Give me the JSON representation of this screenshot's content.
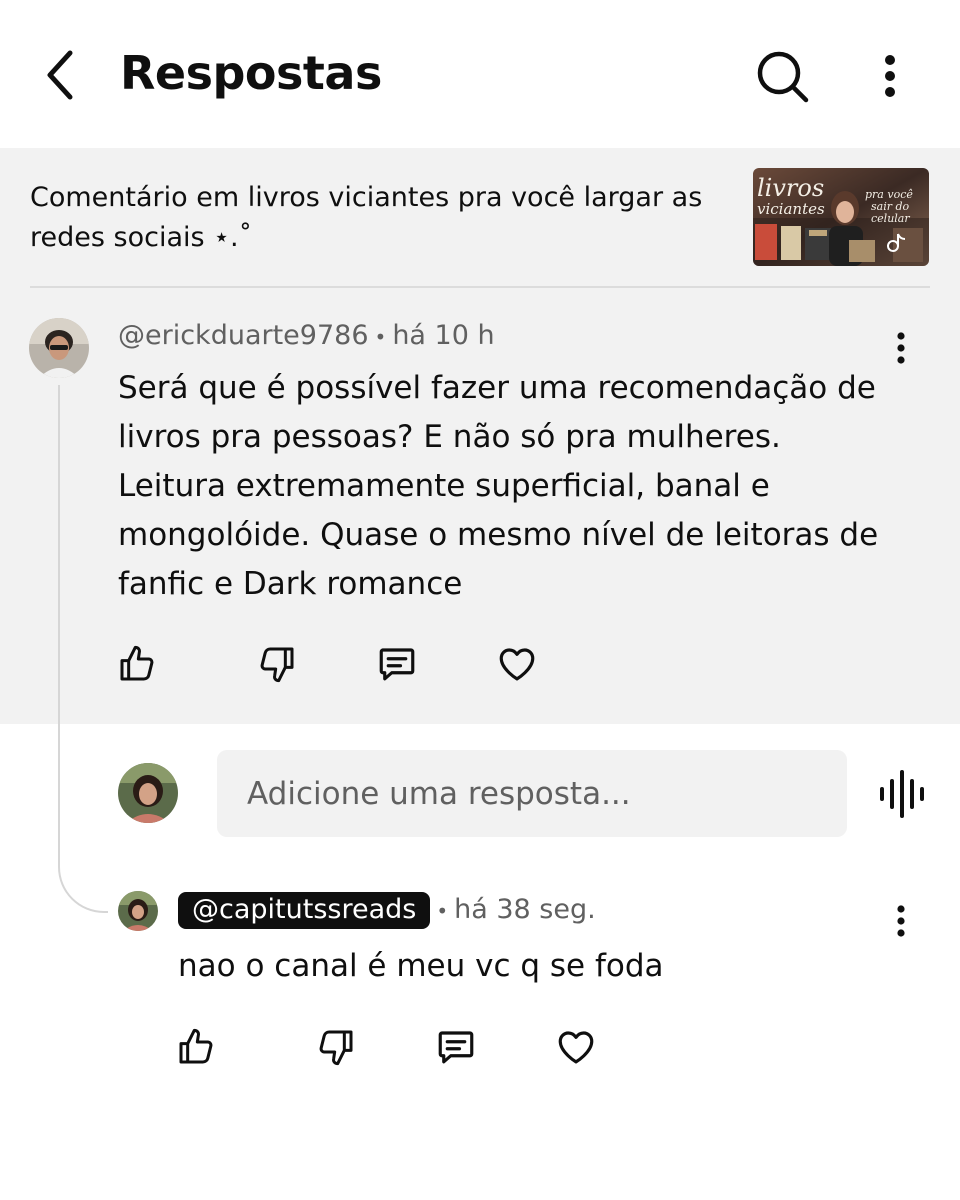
{
  "header": {
    "title": "Respostas",
    "back_icon": "chevron-left-icon",
    "search_icon": "search-icon",
    "more_icon": "more-vertical-icon"
  },
  "video": {
    "title_line1": "Comentário em livros viciantes pra você largar as",
    "title_line2": "redes sociais ⋆.˚",
    "thumbnail": {
      "text_main_1": "livros",
      "text_main_2": "viciantes",
      "text_side_1": "pra você",
      "text_side_2": "sair do",
      "text_side_3": "celular"
    }
  },
  "comment": {
    "author": "@erickduarte9786",
    "time": "há 10 h",
    "body_lines": [
      "Será que é possível fazer uma recomendação de",
      "livros pra pessoas? E não só pra mulheres.",
      "Leitura extremamente superficial, banal e",
      "mongolóide. Quase o mesmo nível de leitoras de",
      "fanfic e Dark romance"
    ]
  },
  "reply_input": {
    "placeholder": "Adicione uma resposta..."
  },
  "reply": {
    "author": "@capitutssreads",
    "time": "há 38 seg.",
    "body": "nao o canal é meu vc q se foda"
  },
  "colors": {
    "shaded_bg": "#f2f2f2",
    "text_primary": "#0f0f0f",
    "text_secondary": "#606060",
    "chip_bg": "#0f0f0f"
  }
}
